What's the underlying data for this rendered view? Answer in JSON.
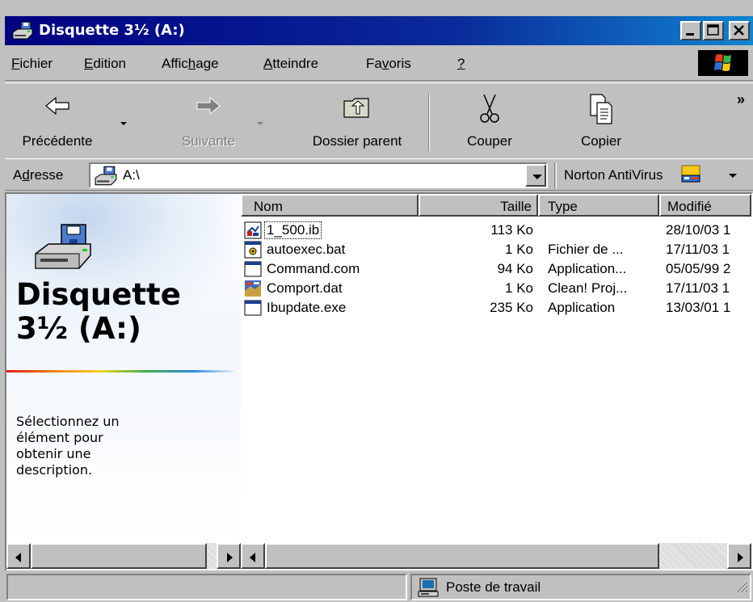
{
  "window": {
    "title": "Disquette 3½ (A:)"
  },
  "menu": [
    {
      "accel": "F",
      "rest": "ichier"
    },
    {
      "accel": "E",
      "rest": "dition"
    },
    {
      "pre": "Affic",
      "accel": "h",
      "rest": "age"
    },
    {
      "accel": "A",
      "rest": "tteindre"
    },
    {
      "pre": "Fa",
      "accel": "v",
      "rest": "oris"
    },
    {
      "accel": "?",
      "rest": ""
    }
  ],
  "toolbar": {
    "back": "Précédente",
    "forward": "Suivante",
    "up": "Dossier parent",
    "cut": "Couper",
    "copy": "Copier",
    "more": "»"
  },
  "address": {
    "label_pre": "A",
    "label_accel": "d",
    "label_rest": "resse",
    "value": "A:\\",
    "norton": "Norton AntiVirus"
  },
  "panel": {
    "title_line1": "Disquette",
    "title_line2": "3½ (A:)",
    "description_lines": [
      "Sélectionnez un",
      "élément pour",
      "obtenir une",
      "description."
    ]
  },
  "columns": {
    "name": "Nom",
    "size": "Taille",
    "type": "Type",
    "modified": "Modifié"
  },
  "files": [
    {
      "name": "1_500.ib",
      "size": "113 Ko",
      "type": "",
      "modified": "28/10/03 1",
      "icon": "ib-file-icon"
    },
    {
      "name": "autoexec.bat",
      "size": "1 Ko",
      "type": "Fichier de ...",
      "modified": "17/11/03 1",
      "icon": "batch-file-icon"
    },
    {
      "name": "Command.com",
      "size": "94 Ko",
      "type": "Application...",
      "modified": "05/05/99 2",
      "icon": "application-icon"
    },
    {
      "name": "Comport.dat",
      "size": "1 Ko",
      "type": "Clean! Proj...",
      "modified": "17/11/03 1",
      "icon": "clean-project-icon"
    },
    {
      "name": "Ibupdate.exe",
      "size": "235 Ko",
      "type": "Application",
      "modified": "13/03/01 1",
      "icon": "application-icon"
    }
  ],
  "status": {
    "location": "Poste de travail"
  },
  "colors": {
    "title_start": "#000080",
    "title_end": "#1084d0",
    "face": "#c0c0c0"
  }
}
